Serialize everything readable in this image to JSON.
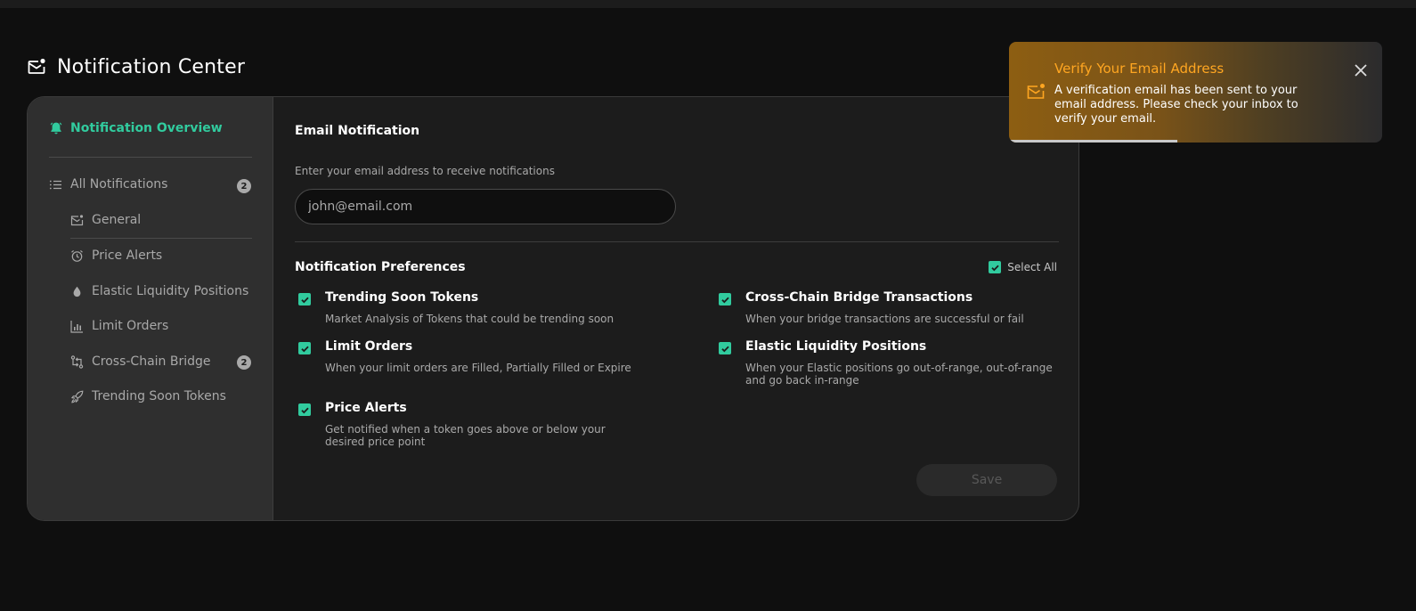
{
  "page": {
    "title": "Notification Center"
  },
  "sidebar": {
    "overview_label": "Notification Overview",
    "all_notifications": {
      "label": "All Notifications",
      "badge": "2"
    },
    "items": [
      {
        "label": "General",
        "icon": "mail-icon"
      },
      {
        "label": "Price Alerts",
        "icon": "alarm-clock-icon"
      },
      {
        "label": "Elastic Liquidity Positions",
        "icon": "droplet-icon"
      },
      {
        "label": "Limit Orders",
        "icon": "bar-chart-icon"
      },
      {
        "label": "Cross-Chain Bridge",
        "icon": "bridge-arrows-icon",
        "badge": "2"
      },
      {
        "label": "Trending Soon Tokens",
        "icon": "rocket-icon"
      }
    ]
  },
  "email": {
    "section_title": "Email Notification",
    "hint": "Enter your email address to receive notifications",
    "placeholder": "john@email.com",
    "value": ""
  },
  "preferences": {
    "title": "Notification Preferences",
    "select_all_label": "Select All",
    "select_all_checked": true,
    "items": [
      {
        "title": "Trending Soon Tokens",
        "description": "Market Analysis of Tokens that could be trending soon",
        "checked": true
      },
      {
        "title": "Cross-Chain Bridge Transactions",
        "description": "When your bridge transactions are successful or fail",
        "checked": true
      },
      {
        "title": "Limit Orders",
        "description": "When your limit orders are Filled, Partially Filled or Expire",
        "checked": true
      },
      {
        "title": "Elastic Liquidity Positions",
        "description": "When your Elastic positions go out-of-range, out-of-range and go back in-range",
        "checked": true
      },
      {
        "title": "Price Alerts",
        "description": "Get notified when a token goes above or below your desired price point",
        "checked": true
      }
    ],
    "save_label": "Save"
  },
  "toast": {
    "title": "Verify Your Email Address",
    "message": "A verification email has been sent to your email address. Please check your inbox to verify your email.",
    "progress": 0.45
  },
  "colors": {
    "accent": "#31cb9e",
    "warning": "#ffa621",
    "background": "#0f0f0f",
    "card": "#1c1c1c",
    "sidebar": "#2f2f2f",
    "muted_text": "#a9a9a9"
  }
}
